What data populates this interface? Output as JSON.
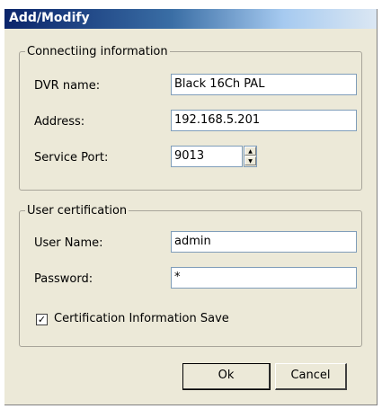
{
  "window": {
    "title": "Add/Modify"
  },
  "connecting": {
    "legend": "Connectiing information",
    "dvr_name_label": "DVR name:",
    "dvr_name_value": "Black 16Ch PAL",
    "address_label": "Address:",
    "address_value": "192.168.5.201",
    "port_label": "Service Port:",
    "port_value": "9013"
  },
  "user_cert": {
    "legend": "User certification",
    "username_label": "User Name:",
    "username_value": "admin",
    "password_label": "Password:",
    "password_value": "*",
    "save_label": "Certification Information Save",
    "save_checked": true
  },
  "buttons": {
    "ok": "Ok",
    "cancel": "Cancel"
  },
  "colors": {
    "titlebar_start": "#0a246a",
    "dialog_bg": "#ece9d8"
  },
  "icons": {
    "spinner_up": "up-arrow-icon",
    "spinner_down": "down-arrow-icon",
    "check": "check-icon"
  }
}
